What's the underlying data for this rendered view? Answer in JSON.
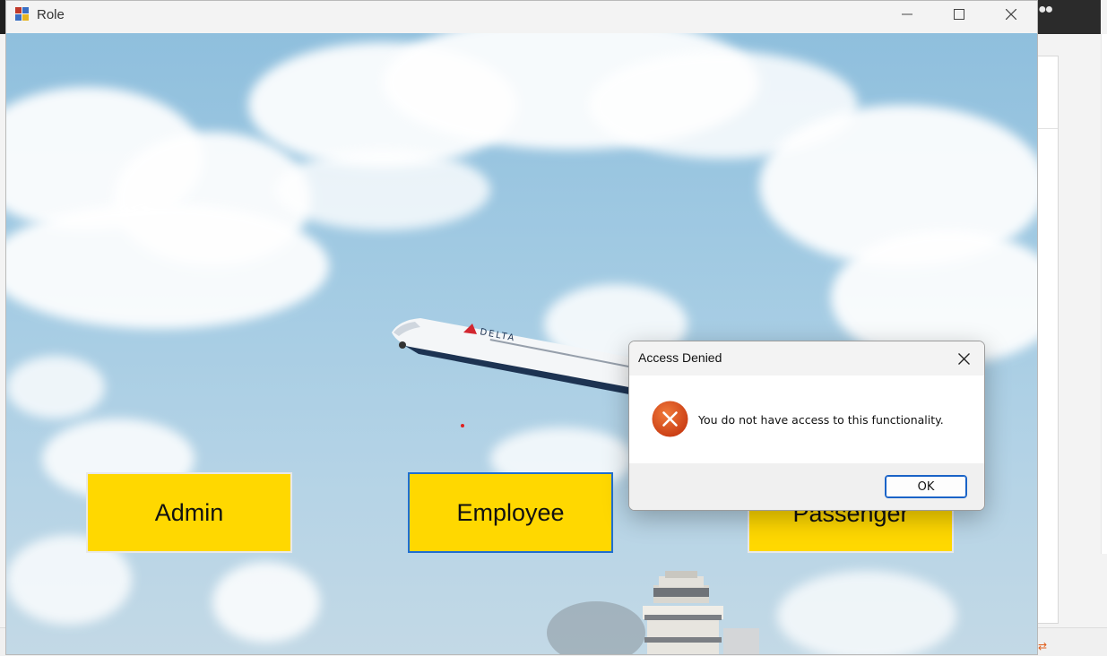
{
  "window": {
    "title": "Role",
    "controls": {
      "minimize_icon": "minimize-icon",
      "maximize_icon": "maximize-icon",
      "close_icon": "close-icon"
    }
  },
  "roles": {
    "admin_label": "Admin",
    "employee_label": "Employee",
    "passenger_label": "Passenger"
  },
  "background_image": {
    "plane_livery_text": "DELTA"
  },
  "dialog": {
    "title": "Access Denied",
    "message": "You do not have access to this functionality.",
    "ok_label": "OK",
    "icon": "error-icon"
  },
  "colors": {
    "role_button": "#ffd800",
    "error_icon": "#d9461b",
    "focus_border": "#1a63c7"
  }
}
